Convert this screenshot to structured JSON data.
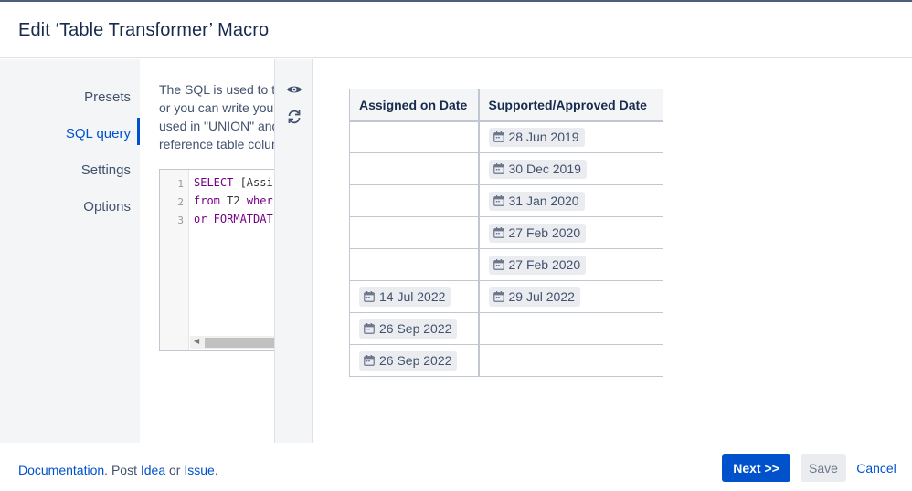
{
  "dialog": {
    "title": "Edit ‘Table Transformer’ Macro"
  },
  "sidebar": {
    "items": [
      {
        "label": "Presets",
        "active": false
      },
      {
        "label": "SQL query",
        "active": true
      },
      {
        "label": "Settings",
        "active": false
      },
      {
        "label": "Options",
        "active": false
      }
    ]
  },
  "sql_pane": {
    "description_lines": [
      "The SQL is used to tr",
      "or you can write you",
      "used in \"UNION\" and",
      "reference table colur"
    ],
    "editor": {
      "line_numbers": [
        "1",
        "2",
        "3"
      ],
      "lines": [
        {
          "keyword": "SELECT",
          "rest": " [Assi"
        },
        {
          "keyword": "from",
          "rest": " T2 ",
          "keyword2": "wher"
        },
        {
          "keyword": "or FORMATDAT",
          "rest": ""
        }
      ]
    }
  },
  "toolbar": {
    "icons": [
      "eye-icon",
      "refresh-icon"
    ]
  },
  "preview": {
    "columns": [
      "Assigned on Date",
      "Supported/Approved Date"
    ],
    "rows": [
      [
        "",
        "28 Jun 2019"
      ],
      [
        "",
        "30 Dec 2019"
      ],
      [
        "",
        "31 Jan 2020"
      ],
      [
        "",
        "27 Feb 2020"
      ],
      [
        "",
        "27 Feb 2020"
      ],
      [
        "14 Jul 2022",
        "29 Jul 2022"
      ],
      [
        "26 Sep 2022",
        ""
      ],
      [
        "26 Sep 2022",
        ""
      ]
    ]
  },
  "footer": {
    "documentation": "Documentation",
    "sep1": ". Post ",
    "idea": "Idea",
    "sep2": " or ",
    "issue": "Issue",
    "sep3": ".",
    "next_label": "Next >>",
    "save_label": "Save",
    "cancel_label": "Cancel"
  },
  "colors": {
    "accent": "#0052cc",
    "sidebar_bg": "#f4f5f7",
    "chip_bg": "#ebecf0"
  }
}
